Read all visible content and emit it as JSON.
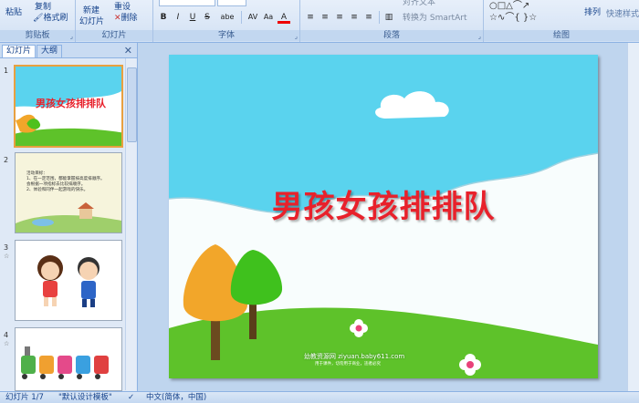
{
  "ribbon": {
    "clipboard": {
      "paste": "粘贴",
      "copy": "复制",
      "format_painter": "格式刷",
      "label": "剪贴板"
    },
    "slides": {
      "new_slide_line1": "新建",
      "new_slide_line2": "幻灯片",
      "reset": "重设",
      "delete": "删除",
      "label": "幻灯片"
    },
    "font": {
      "label": "字体",
      "bold": "B",
      "italic": "I",
      "underline": "U",
      "strike": "S",
      "shadow": "abe",
      "spacing": "AV",
      "case": "Aa",
      "font_color": "A"
    },
    "paragraph": {
      "label": "段落",
      "align_text": "对齐文本",
      "convert_smartart": "转换为 SmartArt"
    },
    "drawing": {
      "arrange": "排列",
      "quick_styles": "快速样式",
      "label": "绘图"
    }
  },
  "pane": {
    "tabs": [
      "幻灯片",
      "大纲"
    ],
    "slides": [
      {
        "number": "1",
        "title": "男孩女孩排排队"
      },
      {
        "number": "2",
        "lines": [
          "活动目标：",
          "1、在一定范围，都能掌握按高度排顺序。",
          "会根据一项指标去比较排顺序。",
          "2、体验和同伴一起游戏的快乐。"
        ]
      },
      {
        "number": "3",
        "anim": "☆"
      },
      {
        "number": "4",
        "anim": "☆"
      }
    ]
  },
  "slide": {
    "title": "男孩女孩排排队",
    "watermark": "幼教资源网 ziyuan.baby611.com",
    "watermark_sub": "用于课件，切勿用于商业，违者必究"
  },
  "status": {
    "slide_counter": "幻灯片 1/7",
    "theme": "\"默认设计模板\"",
    "language": "中文(简体，中国)"
  },
  "colors": {
    "sky": "#5ad3ee",
    "grass": "#5ec22a",
    "title": "#e8212b",
    "ribbon": "#d2e1f4"
  }
}
